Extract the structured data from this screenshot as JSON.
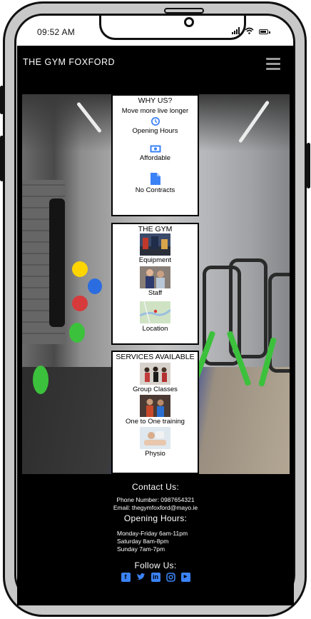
{
  "status": {
    "time": "09:52 AM"
  },
  "nav": {
    "brand": "THE GYM FOXFORD",
    "menu_icon": "hamburger-menu-icon"
  },
  "why_us": {
    "title": "WHY US?",
    "tagline": "Move more live longer",
    "items": [
      {
        "label": "Opening Hours",
        "icon": "clock-icon"
      },
      {
        "label": "Affordable",
        "icon": "money-icon"
      },
      {
        "label": "No Contracts",
        "icon": "document-icon"
      }
    ]
  },
  "the_gym": {
    "title": "THE GYM",
    "items": [
      {
        "label": "Equipment"
      },
      {
        "label": "Staff"
      },
      {
        "label": "Location"
      }
    ]
  },
  "services": {
    "title": "SERVICES AVAILABLE",
    "items": [
      {
        "label": "Group Classes"
      },
      {
        "label": "One to One training"
      },
      {
        "label": "Physio"
      }
    ]
  },
  "footer": {
    "contact_heading": "Contact Us:",
    "phone": "Phone Number: 0987654321",
    "email": "Email: thegymfoxford@mayo.ie",
    "hours_heading": "Opening Hours:",
    "hours": [
      "Monday-Friday 6am-11pm",
      "Saturday 8am-8pm",
      "Sunday 7am-7pm"
    ],
    "follow_heading": "Follow Us:",
    "social": [
      "facebook-icon",
      "twitter-icon",
      "linkedin-icon",
      "instagram-icon",
      "youtube-icon"
    ]
  },
  "colors": {
    "accent": "#3b82f6",
    "background": "#000000"
  }
}
